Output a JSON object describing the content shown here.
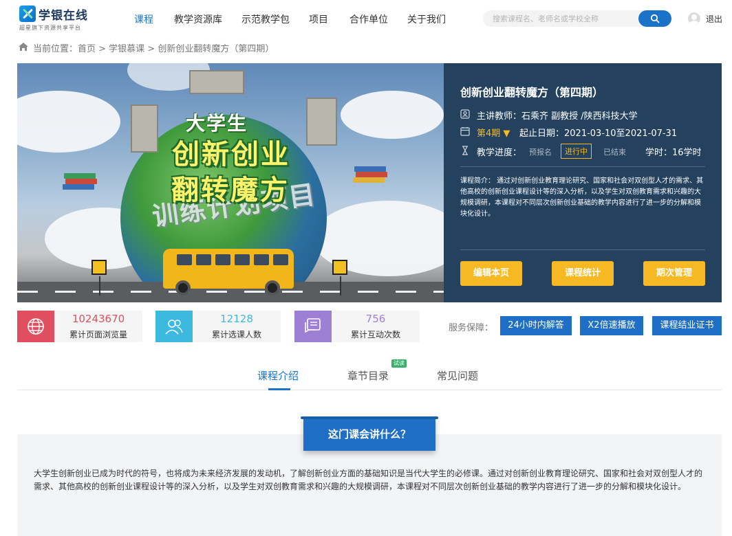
{
  "header": {
    "logo_name": "学银在线",
    "logo_slogan": "超星旗下资源共享平台",
    "nav": [
      "课程",
      "教学资源库",
      "示范教学包",
      "项目",
      "合作单位",
      "关于我们"
    ],
    "search_placeholder": "搜索课程名、老师名或学校全称",
    "logout": "退出"
  },
  "breadcrumb": "当前位置：首页 > 学银慕课 > 创新创业翻转魔方（第四期）",
  "banner": {
    "line1": "大学生",
    "line2": "创新创业",
    "line3": "翻转魔方",
    "line4": "训练计划项目"
  },
  "course": {
    "title": "创新创业翻转魔方（第四期）",
    "teacher": "主讲教师：石乘齐 副教授 /陕西科技大学",
    "term": "第4期 ▼",
    "dates": "起止日期：2021-03-10至2021-07-31",
    "progress_label": "教学进度：",
    "stages": [
      "预报名",
      "进行中",
      "已结束"
    ],
    "hours": "学时：16学时",
    "intro": "课程简介： 通过对创新创业教育理论研究、国家和社会对双创型人才的需求、其他高校的创新创业课程设计等的深入分析，以及学生对双创教育需求和兴趣的大规模调研，本课程对不同层次创新创业基础的教学内容进行了进一步的分解和模块化设计。",
    "buttons": [
      "编辑本页",
      "课程统计",
      "期次管理"
    ]
  },
  "stats": [
    {
      "value": "10243670",
      "label": "累计页面浏览量",
      "color": "#e04f5f"
    },
    {
      "value": "12128",
      "label": "累计选课人数",
      "color": "#3db9e0"
    },
    {
      "value": "756",
      "label": "累计互动次数",
      "color": "#9e7fd6"
    }
  ],
  "service": {
    "label": "服务保障：",
    "items": [
      "24小时内解答",
      "X2倍速播放",
      "课程结业证书"
    ]
  },
  "tabs": {
    "items": [
      "课程介绍",
      "章节目录",
      "常见问题"
    ],
    "badge": "试读"
  },
  "content": {
    "title": "这门课会讲什么？",
    "text": "大学生创新创业已成为时代的符号，也将成为未来经济发展的发动机，了解创新创业方面的基础知识是当代大学生的必修课。通过对创新创业教育理论研究、国家和社会对双创型人才的需求、其他高校的创新创业课程设计等的深入分析，以及学生对双创教育需求和兴趣的大规模调研，本课程对不同层次创新创业基础的教学内容进行了进一步的分解和模块化设计。"
  }
}
